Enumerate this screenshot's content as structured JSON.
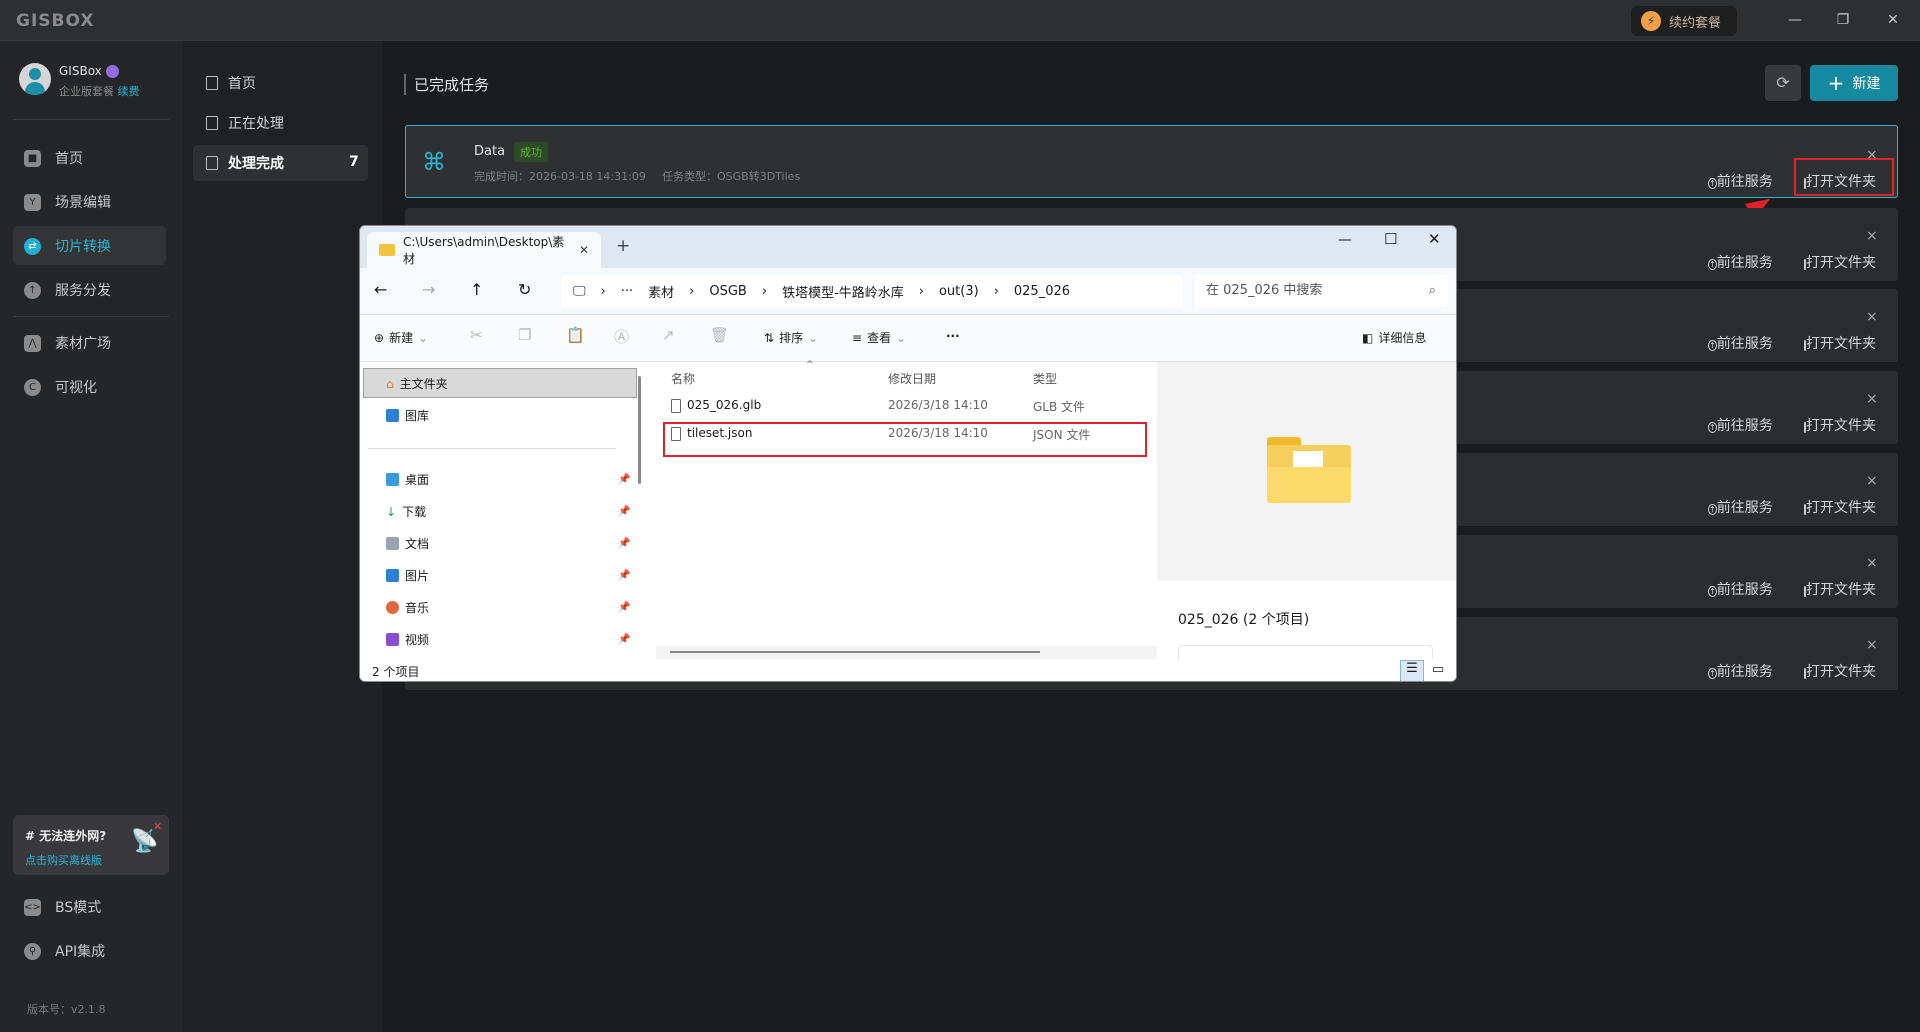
{
  "app": {
    "logo": "GISBOX",
    "renew_label": "续约套餐"
  },
  "user": {
    "name": "GISBox",
    "plan": "企业版套餐",
    "renew_link": "续费"
  },
  "sidebar": {
    "items": [
      {
        "label": "首页",
        "icon": "home-icon"
      },
      {
        "label": "场景编辑",
        "icon": "cube-icon"
      },
      {
        "label": "切片转换",
        "icon": "convert-icon"
      },
      {
        "label": "服务分发",
        "icon": "cloud-upload-icon"
      },
      {
        "label": "素材广场",
        "icon": "mountain-icon"
      },
      {
        "label": "可视化",
        "icon": "visual-icon"
      }
    ],
    "promo": {
      "title": "# 无法连外网?",
      "link": "点击购买离线版"
    },
    "bottom_items": [
      {
        "label": "BS模式"
      },
      {
        "label": "API集成"
      }
    ],
    "version": "版本号：v2.1.8"
  },
  "subnav": {
    "items": [
      {
        "label": "首页"
      },
      {
        "label": "正在处理"
      },
      {
        "label": "处理完成",
        "count": "7"
      }
    ]
  },
  "main": {
    "title": "已完成任务",
    "new_label": "新建",
    "tasks": [
      {
        "name": "Data",
        "status": "成功",
        "time": "完成时间：2026-03-18 14:31:09",
        "type": "任务类型：OSGB转3DTiles"
      }
    ],
    "action_service": "前往服务",
    "action_folder": "打开文件夹",
    "close": "×"
  },
  "explorer": {
    "tab_title": "C:\\Users\\admin\\Desktop\\素材",
    "breadcrumb": [
      "素材",
      "OSGB",
      "铁塔模型-牛路岭水库",
      "out(3)",
      "025_026"
    ],
    "search_placeholder": "在 025_026 中搜索",
    "toolbar": {
      "new": "新建",
      "sort": "排序",
      "view": "查看",
      "more": "···",
      "details": "详细信息"
    },
    "nav_pane": [
      {
        "label": "主文件夹"
      },
      {
        "label": "图库"
      },
      {
        "label": "桌面"
      },
      {
        "label": "下载"
      },
      {
        "label": "文档"
      },
      {
        "label": "图片"
      },
      {
        "label": "音乐"
      },
      {
        "label": "视频"
      }
    ],
    "columns": [
      "名称",
      "修改日期",
      "类型"
    ],
    "files": [
      {
        "name": "025_026.glb",
        "date": "2026/3/18 14:10",
        "type": "GLB 文件"
      },
      {
        "name": "tileset.json",
        "date": "2026/3/18 14:10",
        "type": "JSON 文件"
      }
    ],
    "detail_title": "025_026 (2 个项目)",
    "status": "2 个项目"
  },
  "colors": {
    "accent": "#14899f",
    "highlight": "#e0232b",
    "success": "#5cb82a"
  }
}
